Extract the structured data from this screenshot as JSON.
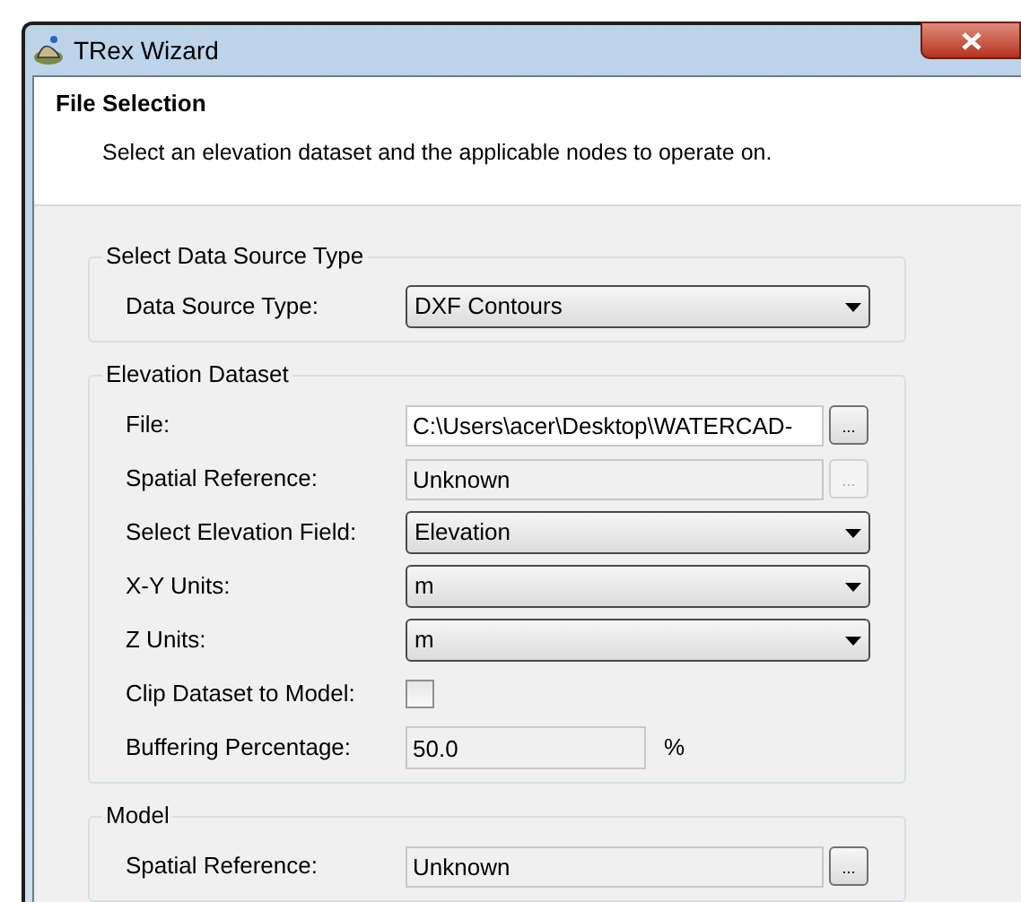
{
  "window": {
    "title": "TRex Wizard"
  },
  "header": {
    "title": "File Selection",
    "description": "Select an elevation dataset and the applicable nodes to operate on."
  },
  "groups": [
    {
      "title": "Select Data Source Type",
      "rows": [
        {
          "kind": "combo",
          "label": "Data Source Type:",
          "value": "DXF Contours"
        }
      ]
    },
    {
      "title": "Elevation Dataset",
      "rows": [
        {
          "kind": "text",
          "label": "File:",
          "value": "C:\\Users\\acer\\Desktop\\WATERCAD-",
          "disabled": false,
          "browse": {
            "label": "...",
            "disabled": false
          }
        },
        {
          "kind": "text",
          "label": "Spatial Reference:",
          "value": "Unknown",
          "disabled": true,
          "browse": {
            "label": "...",
            "disabled": true
          }
        },
        {
          "kind": "combo",
          "label": "Select Elevation Field:",
          "value": "Elevation"
        },
        {
          "kind": "combo",
          "label": "X-Y Units:",
          "value": "m"
        },
        {
          "kind": "combo",
          "label": "Z Units:",
          "value": "m"
        },
        {
          "kind": "checkbox",
          "label": "Clip Dataset to Model:",
          "checked": false
        },
        {
          "kind": "number",
          "label": "Buffering Percentage:",
          "value": "50.0",
          "unit": "%"
        }
      ]
    },
    {
      "title": "Model",
      "rows": [
        {
          "kind": "text",
          "label": "Spatial Reference:",
          "value": "Unknown",
          "disabled": true,
          "browse": {
            "label": "...",
            "disabled": false
          }
        }
      ]
    }
  ]
}
